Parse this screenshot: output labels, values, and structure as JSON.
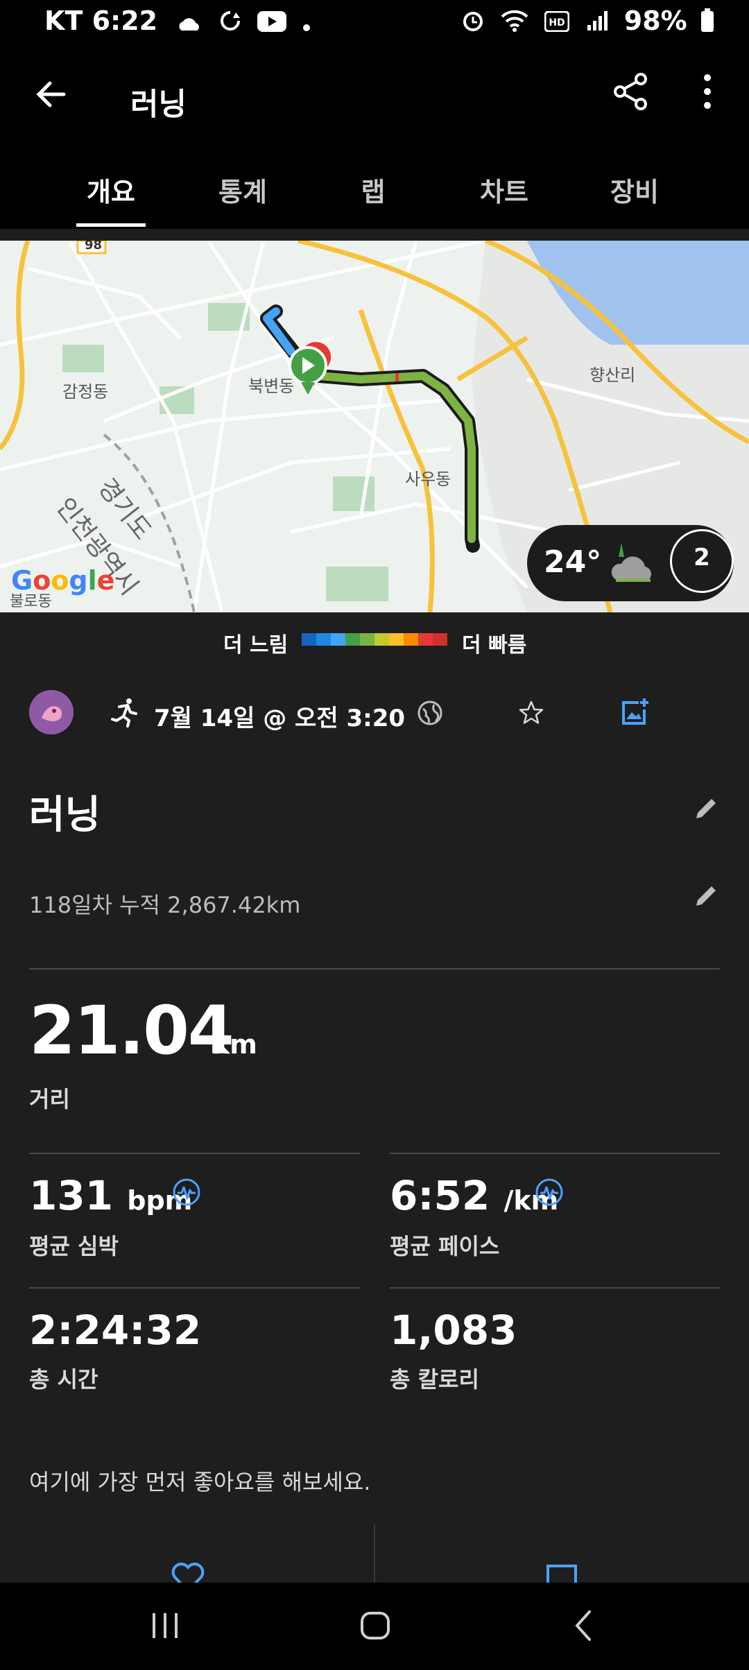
{
  "status_bar": {
    "carrier_time": "KT 6:22",
    "battery": "98%"
  },
  "app_bar": {
    "title": "러닝"
  },
  "tabs": [
    {
      "label": "개요",
      "active": true
    },
    {
      "label": "통계",
      "active": false
    },
    {
      "label": "랩",
      "active": false
    },
    {
      "label": "차트",
      "active": false
    },
    {
      "label": "장비",
      "active": false
    }
  ],
  "map": {
    "labels": {
      "gamjeong": "감정동",
      "bukbyeon": "북변동",
      "hyangsan": "향산리",
      "sau": "사우동",
      "gyeonggi": "경기도",
      "incheon": "인천광역시",
      "bul": "불로동",
      "road": "98",
      "google": "Google"
    },
    "weather_temp": "24°",
    "weather_badge": "2"
  },
  "legend": {
    "slower": "더 느림",
    "faster": "더 빠름",
    "colors": [
      "#1565c0",
      "#1e88e5",
      "#42a5f5",
      "#43a047",
      "#7cb342",
      "#c0ca33",
      "#fbc02d",
      "#fb8c00",
      "#e53935",
      "#d32f2f"
    ]
  },
  "activity": {
    "datetime": "7월 14일 @ 오전 3:20",
    "title": "러닝",
    "description": "118일차 누적 2,867.42km"
  },
  "stats": {
    "distance": {
      "value": "21.04",
      "unit": "km",
      "label": "거리"
    },
    "avg_hr": {
      "value": "131",
      "unit": "bpm",
      "label": "평균 심박"
    },
    "avg_pace": {
      "value": "6:52",
      "unit": "/km",
      "label": "평균 페이스"
    },
    "total_time": {
      "value": "2:24:32",
      "label": "총 시간"
    },
    "calories": {
      "value": "1,083",
      "label": "총 칼로리"
    }
  },
  "social": {
    "like_prompt": "여기에 가장 먼저 좋아요를 해보세요."
  },
  "accent_color": "#4aa3ff"
}
